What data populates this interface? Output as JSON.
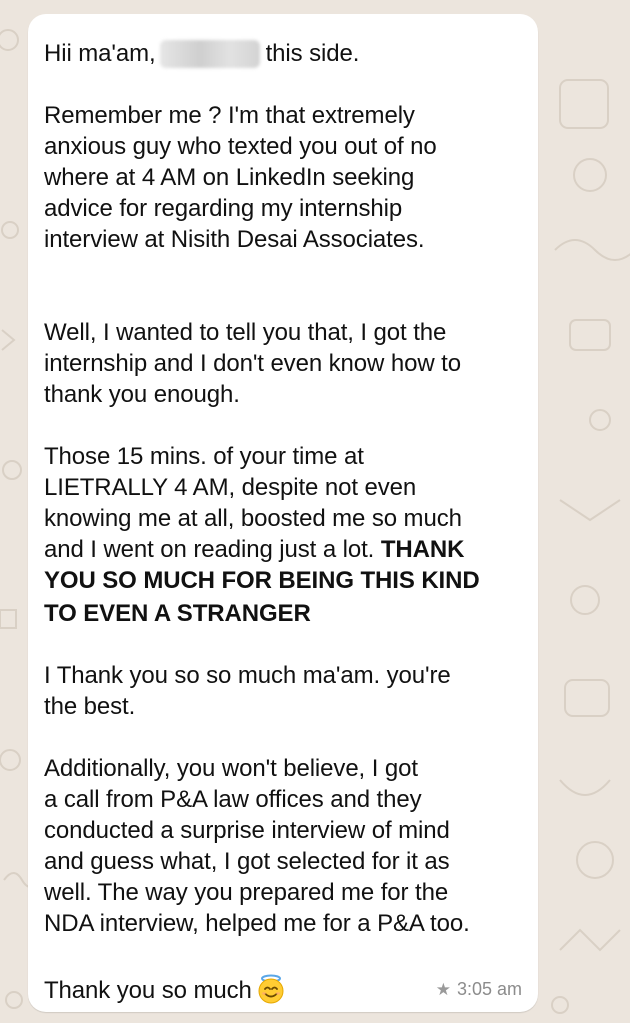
{
  "colors": {
    "background": "#ece5dd",
    "bubble": "#ffffff",
    "text": "#111111",
    "meta_text": "#8c8c8c"
  },
  "message": {
    "greeting_before": "Hii ma'am,",
    "greeting_after": "this side.",
    "p1": [
      "Remember me ? I'm that extremely",
      "anxious guy who texted you out of no",
      "where at 4 AM on LinkedIn seeking",
      "advice for regarding my internship",
      "interview at Nisith Desai Associates."
    ],
    "p2": [
      "Well, I wanted to tell you that, I got the",
      "internship and I don't even know how to",
      "thank you enough."
    ],
    "p3": [
      "Those 15 mins. of your time at",
      "LIETRALLY 4 AM, despite not even",
      "knowing me at all, boosted me so much"
    ],
    "p3_line4_normal": "and I went on reading just a lot. ",
    "p3_line4_bold": "THANK",
    "p3_bold": [
      "YOU SO MUCH FOR BEING THIS KIND",
      "TO EVEN A STRANGER"
    ],
    "p4": [
      "I Thank you so so much ma'am. you're",
      "the best."
    ],
    "p5": [
      "Additionally, you won't believe, I got",
      "a call from P&A law offices and they",
      "conducted a surprise interview of mind",
      "and guess what, I got selected for it as",
      "well. The way you prepared me for the",
      "NDA interview, helped me for a P&A too."
    ],
    "closing": "Thank you so much",
    "emoji": "smiling-face-with-halo",
    "starred_icon": "star-icon",
    "time": "3:05 am"
  }
}
